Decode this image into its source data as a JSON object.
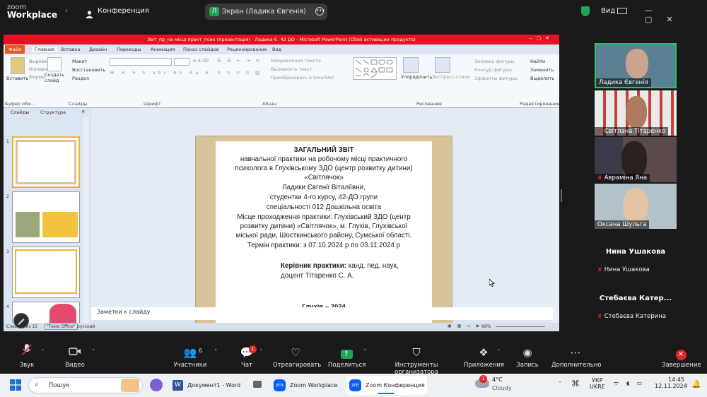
{
  "zoom": {
    "logo_top": "zoom",
    "logo_bottom": "Workplace",
    "conference_label": "Конференция",
    "share_badge": "Л",
    "share_title": "Экран (Ладика Євгенія)",
    "view_label": "Вид",
    "window_controls": "—▢✕"
  },
  "ppt": {
    "title": "Звіт_пр_на місці практ_псих (презентація) - Ладика Є. 42 ДО - Microsoft PowerPoint (Сбой активации продукта)",
    "tabs": [
      "Файл",
      "Главная",
      "Вставка",
      "Дизайн",
      "Переходы",
      "Анимация",
      "Показ слайдов",
      "Рецензирование",
      "Вид"
    ],
    "ribbon": {
      "paste": "Вставить",
      "cut": "Вырезать",
      "copy": "Копировать",
      "format_painter": "Формат по образцу",
      "new_slide": "Создать слайд",
      "layout": "Макет",
      "reset": "Восстановить",
      "section": "Раздел",
      "text_direction": "Направление текста",
      "align_text": "Выровнять текст",
      "smartart": "Преобразовать в SmartArt",
      "arrange": "Упорядочить",
      "quick_styles": "Экспресс-стили",
      "shape_fill": "Заливка фигуры",
      "shape_outline": "Контур фигуры",
      "shape_effects": "Эффекты фигуры",
      "find": "Найти",
      "replace": "Заменить",
      "select": "Выделить",
      "grp_clipboard": "Буфер обм...",
      "grp_slides": "Слайды",
      "grp_font": "Шрифт",
      "grp_paragraph": "Абзац",
      "grp_drawing": "Рисование",
      "grp_editing": "Редактирование"
    },
    "panel_tabs": [
      "Слайды",
      "Структура"
    ],
    "thumbs": [
      "1",
      "2",
      "3",
      "4"
    ],
    "slide": {
      "title": "ЗАГАЛЬНИЙ ЗВІТ",
      "lines": [
        "навчальної практики на робочому місці практичного",
        "психолога в Глухівському ЗДО (центр розвитку дитини)",
        "«Світлячок»",
        "Ладики Євгенії Віталіївни,",
        "студентки 4-го курсу, 42-ДО групи",
        "спеціальності 012 Дошкільна освіта",
        "Місце проходження практики: Глухівський  ЗДО (центр",
        "розвитку дитини)  «Світлячок», м. Глухів, Глухівської",
        "міської ради, Шосткинського району, Сумської області.",
        "Термін практики: з 07.10.2024 р по 03.11.2024 р"
      ],
      "supervisor_bold": "Керівник практики:",
      "supervisor_rest": " канд. пед. наук,",
      "supervisor_line2": "доцент Тітаренко С. А.",
      "footer": "Глухів – 2024"
    },
    "notes_placeholder": "Заметки к слайду",
    "status": {
      "slide": "Слайд 1 из 15",
      "theme": "\"Тема Office\"",
      "lang": "русский",
      "zoom": "66%"
    }
  },
  "participants": [
    {
      "name": "Ладика Євгенія",
      "muted": false
    },
    {
      "name": "Світлана Тітаренко",
      "muted": true
    },
    {
      "name": "Авраміна Яна",
      "muted": true
    },
    {
      "name": "Оксана Шульга",
      "muted": false
    }
  ],
  "participants_text": [
    {
      "title": "Нина Ушакова",
      "name": "Нина Ушакова"
    },
    {
      "title": "Стебаєва Катер...",
      "name": "Стебаєва Катерина"
    }
  ],
  "toolbar": {
    "audio": "Звук",
    "video": "Видео",
    "participants": "Участники",
    "participants_count": "6",
    "chat": "Чат",
    "chat_badge": "1",
    "react": "Отреагировать",
    "share": "Поделиться",
    "host_tools": "Инструменты организатора",
    "apps": "Приложения",
    "record": "Запись",
    "more": "Дополнительно",
    "end": "Завершение"
  },
  "taskbar": {
    "search": "Пошук",
    "word": "Документ1 - Word",
    "zoom_workplace": "Zoom Workplace",
    "zoom_conf": "Zoom Конференция",
    "weather_temp": "4°C",
    "weather_desc": "Cloudy",
    "weather_badge": "1",
    "lang1": "УКР",
    "lang2": "UKRE",
    "time": "14:45",
    "date": "12.11.2024"
  }
}
